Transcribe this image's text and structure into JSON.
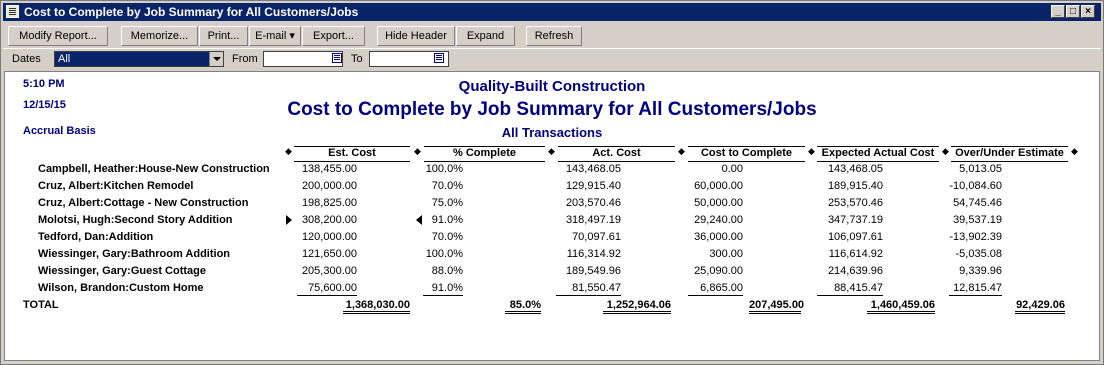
{
  "window": {
    "title": "Cost to Complete by Job Summary for All Customers/Jobs"
  },
  "toolbar": {
    "modify_report": "Modify Report...",
    "memorize": "Memorize...",
    "print": "Print...",
    "email": "E-mail ▾",
    "export": "Export...",
    "hide_header": "Hide Header",
    "expand": "Expand",
    "refresh": "Refresh"
  },
  "filters": {
    "dates_label": "Dates",
    "dates_value": "All",
    "from_label": "From",
    "from_value": "",
    "to_label": "To",
    "to_value": ""
  },
  "report": {
    "time": "5:10 PM",
    "date": "12/15/15",
    "basis": "Accrual Basis",
    "company": "Quality-Built Construction",
    "title": "Cost to Complete by Job Summary for All Customers/Jobs",
    "subtitle": "All Transactions",
    "columns": [
      "Est. Cost",
      "% Complete",
      "Act. Cost",
      "Cost to Complete",
      "Expected Actual Cost",
      "Over/Under Estimate"
    ],
    "rows": [
      {
        "name": "Campbell, Heather:House-New Construction",
        "est": "138,455.00",
        "pct": "100.0%",
        "act": "143,468.05",
        "ctc": "0.00",
        "exp": "143,468.05",
        "ou": "5,013.05"
      },
      {
        "name": "Cruz, Albert:Kitchen Remodel",
        "est": "200,000.00",
        "pct": "70.0%",
        "act": "129,915.40",
        "ctc": "60,000.00",
        "exp": "189,915.40",
        "ou": "-10,084.60"
      },
      {
        "name": "Cruz, Albert:Cottage - New Construction",
        "est": "198,825.00",
        "pct": "75.0%",
        "act": "203,570.46",
        "ctc": "50,000.00",
        "exp": "253,570.46",
        "ou": "54,745.46"
      },
      {
        "name": "Molotsi, Hugh:Second Story Addition",
        "est": "308,200.00",
        "pct": "91.0%",
        "act": "318,497.19",
        "ctc": "29,240.00",
        "exp": "347,737.19",
        "ou": "39,537.19"
      },
      {
        "name": "Tedford, Dan:Addition",
        "est": "120,000.00",
        "pct": "70.0%",
        "act": "70,097.61",
        "ctc": "36,000.00",
        "exp": "106,097.61",
        "ou": "-13,902.39"
      },
      {
        "name": "Wiessinger, Gary:Bathroom Addition",
        "est": "121,650.00",
        "pct": "100.0%",
        "act": "116,314.92",
        "ctc": "300.00",
        "exp": "116,614.92",
        "ou": "-5,035.08"
      },
      {
        "name": "Wiessinger, Gary:Guest Cottage",
        "est": "205,300.00",
        "pct": "88.0%",
        "act": "189,549.96",
        "ctc": "25,090.00",
        "exp": "214,639.96",
        "ou": "9,339.96"
      },
      {
        "name": "Wilson, Brandon:Custom Home",
        "est": "75,600.00",
        "pct": "91.0%",
        "act": "81,550.47",
        "ctc": "6,865.00",
        "exp": "88,415.47",
        "ou": "12,815.47"
      }
    ],
    "total": {
      "label": "TOTAL",
      "est": "1,368,030.00",
      "pct": "85.0%",
      "act": "1,252,964.06",
      "ctc": "207,495.00",
      "exp": "1,460,459.06",
      "ou": "92,429.06"
    }
  }
}
